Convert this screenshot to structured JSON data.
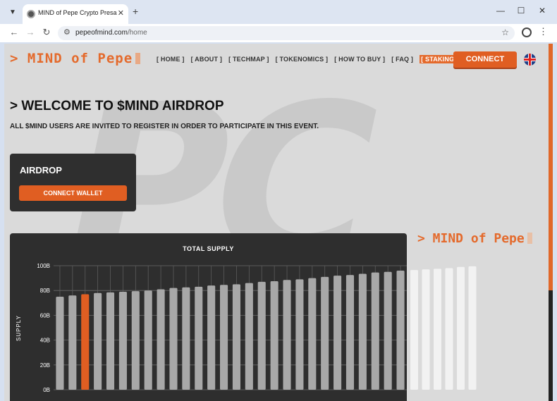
{
  "browser": {
    "tab_title": "MIND of Pepe Crypto Presale | ¦",
    "url_domain": "pepeofmind.com",
    "url_path": "/home",
    "icons": [
      "chevron-down-icon",
      "close-icon",
      "plus-icon",
      "minimize-icon",
      "maximize-icon",
      "back-icon",
      "forward-icon",
      "reload-icon",
      "site-info-icon",
      "star-icon",
      "profile-icon",
      "more-icon"
    ]
  },
  "header": {
    "logo": "> MIND of Pepe",
    "nav": [
      {
        "label": "[ HOME ]"
      },
      {
        "label": "[ ABOUT ]"
      },
      {
        "label": "[ TECHMAP ]"
      },
      {
        "label": "[ TOKENOMICS ]"
      },
      {
        "label": "[ HOW TO BUY ]"
      },
      {
        "label": "[ FAQ ]"
      },
      {
        "label": "[ STAKING ]"
      }
    ],
    "connect_label": "CONNECT"
  },
  "hero": {
    "title": "> WELCOME TO $MIND AIRDROP",
    "subtitle": "ALL $MIND USERS ARE INVITED TO REGISTER IN ORDER TO PARTICIPATE IN THIS EVENT."
  },
  "airdrop": {
    "title": "AIRDROP",
    "button_label": "CONNECT WALLET"
  },
  "side_logo": "> MIND of Pepe",
  "colors": {
    "accent": "#e05e22",
    "page_bg": "#dadada",
    "card_bg": "#2e2e2e"
  },
  "chart_data": {
    "type": "bar",
    "title": "TOTAL SUPPLY",
    "ylabel": "SUPPLY",
    "xlabel": "",
    "y_ticks": [
      "0B",
      "20B",
      "40B",
      "60B",
      "80B",
      "100B"
    ],
    "ylim": [
      0,
      100
    ],
    "grid": true,
    "values": [
      75,
      76,
      77,
      78,
      78.5,
      79,
      79.5,
      80,
      81,
      82,
      82.5,
      83,
      84,
      84.5,
      85,
      86,
      87,
      87.5,
      88.5,
      89,
      90,
      91,
      92,
      92.5,
      93.5,
      94.5,
      95,
      96
    ],
    "highlight_index": 2,
    "overflow_values": [
      96.5,
      97,
      97.5,
      98,
      99,
      99.5
    ]
  }
}
